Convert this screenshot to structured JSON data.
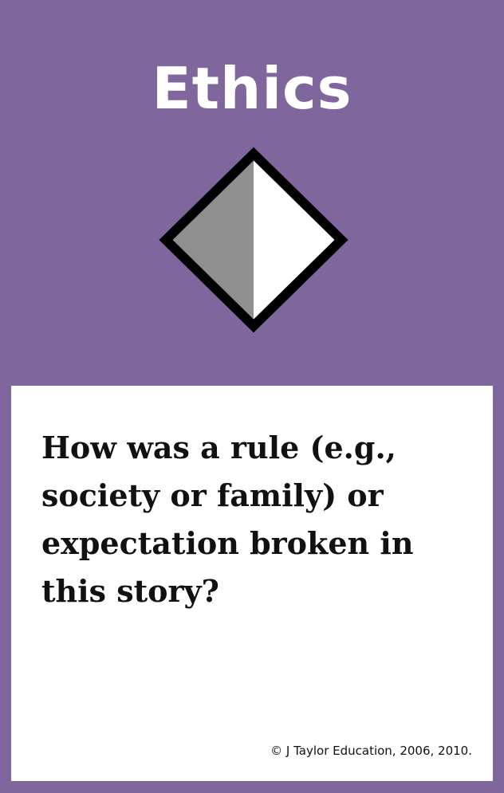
{
  "card": {
    "category": "Ethics",
    "question": "How was a rule (e.g., society or family) or expectation broken in this story?",
    "copyright": "© J Taylor Education, 2006, 2010.",
    "symbol": "half-filled-diamond-icon"
  },
  "colors": {
    "background": "#7f679e",
    "panel": "#ffffff",
    "text": "#111111",
    "diamond_outline": "#000000",
    "diamond_left": "#8f8f8f",
    "diamond_right": "#ffffff"
  }
}
